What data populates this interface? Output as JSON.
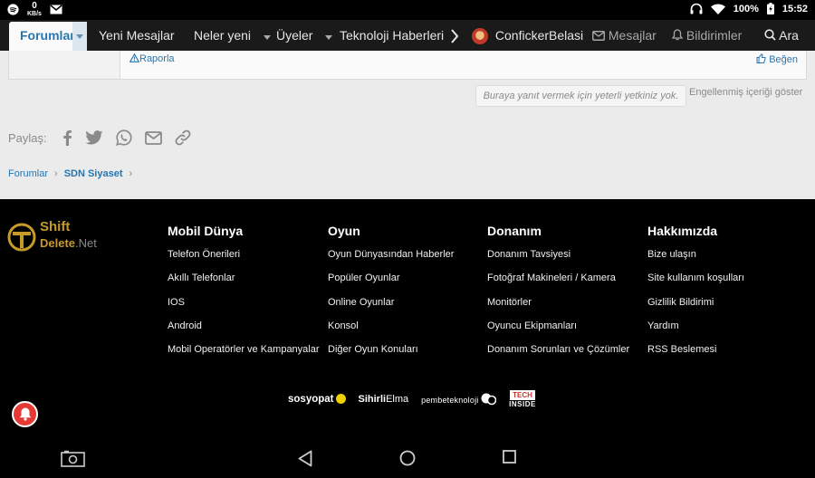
{
  "status_bar": {
    "speed_value": "0",
    "speed_unit": "KB/s",
    "battery": "100%",
    "time": "15:52"
  },
  "nav": {
    "active_tab": "Forumlar",
    "items": [
      "Yeni Mesajlar",
      "Neler yeni",
      "Üyeler",
      "Teknoloji Haberleri"
    ],
    "username": "ConfickerBelasi",
    "messages": "Mesajlar",
    "alerts": "Bildirimler",
    "search": "Ara"
  },
  "post": {
    "report": "Raporla",
    "like": "Beğen"
  },
  "reply_notice": "Buraya yanıt vermek için yeterli yetkiniz yok.",
  "blocked_toggle": "Engellenmiş içeriği göster",
  "share": {
    "label": "Paylaş:",
    "icons": [
      "facebook-icon",
      "twitter-icon",
      "whatsapp-icon",
      "email-icon",
      "link-icon"
    ]
  },
  "breadcrumb": [
    "Forumlar",
    "SDN Siyaset"
  ],
  "footer": {
    "logo_line1": "Shift",
    "logo_line2": "Delete",
    "logo_suffix": ".Net",
    "columns": [
      {
        "title": "Mobil Dünya",
        "links": [
          "Telefon Önerileri",
          "Akıllı Telefonlar",
          "IOS",
          "Android",
          "Mobil Operatörler ve Kampanyalar"
        ]
      },
      {
        "title": "Oyun",
        "links": [
          "Oyun Dünyasından Haberler",
          "Popüler Oyunlar",
          "Online Oyunlar",
          "Konsol",
          "Diğer Oyun Konuları"
        ]
      },
      {
        "title": "Donanım",
        "links": [
          "Donanım Tavsiyesi",
          "Fotoğraf Makineleri / Kamera",
          "Monitörler",
          "Oyuncu Ekipmanları",
          "Donanım Sorunları ve Çözümler"
        ]
      },
      {
        "title": "Hakkımızda",
        "links": [
          "Bize ulaşın",
          "Site kullanım koşulları",
          "Gizlilik Bildirimi",
          "Yardım",
          "RSS Beslemesi"
        ]
      }
    ],
    "partners": {
      "sosyopat": "sosyopat",
      "sihirli": "Sihirli",
      "elma": "Elma",
      "pembe": "pembeteknoloji",
      "tech": "TECH",
      "inside": "INSIDE"
    }
  },
  "colors": {
    "accent": "#2577b1",
    "brand_gold": "#c79a2a",
    "notification": "#e53935"
  }
}
